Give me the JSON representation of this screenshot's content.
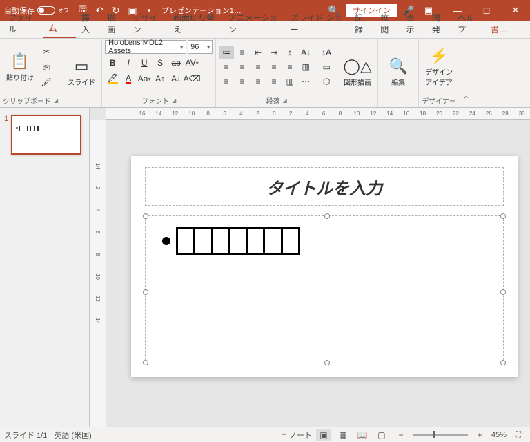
{
  "titlebar": {
    "autosave_label": "自動保存",
    "autosave_state": "オフ",
    "doc_title": "プレゼンテーション1…",
    "signin": "サインイン"
  },
  "tabs": {
    "file": "ファイル",
    "home": "ホーム",
    "insert": "挿入",
    "draw": "描画",
    "design": "デザイン",
    "transition": "画面切り替え",
    "animation": "アニメーション",
    "slideshow": "スライド ショー",
    "record": "記録",
    "review": "校閲",
    "view": "表示",
    "developer": "開発",
    "help": "ヘルプ",
    "shape_format": "図形の書…"
  },
  "ribbon": {
    "groups": {
      "clipboard": "クリップボード",
      "slides": "",
      "font": "フォント",
      "paragraph": "段落",
      "drawing": "",
      "editing": "",
      "designer": "デザイナー"
    },
    "paste": "貼り付け",
    "slide_btn": "スライド",
    "font_name": "HoloLens MDL2 Assets",
    "font_size": "96",
    "shape_draw": "図形描画",
    "edit": "編集",
    "design_idea": "デザイン\nアイデア"
  },
  "slide": {
    "title": "タイトルを入力",
    "thumb_number": "1"
  },
  "ruler_h": [
    "16",
    "14",
    "12",
    "10",
    "8",
    "6",
    "4",
    "2",
    "0",
    "2",
    "4",
    "6",
    "8",
    "10",
    "12",
    "14",
    "16",
    "18",
    "20",
    "22",
    "24",
    "26",
    "28",
    "30"
  ],
  "ruler_v": [
    "14",
    "2",
    "4",
    "6",
    "8",
    "10",
    "12",
    "14"
  ],
  "status": {
    "slide_info": "スライド 1/1",
    "language": "英語 (米国)",
    "notes": "ノート",
    "zoom": "45%"
  }
}
